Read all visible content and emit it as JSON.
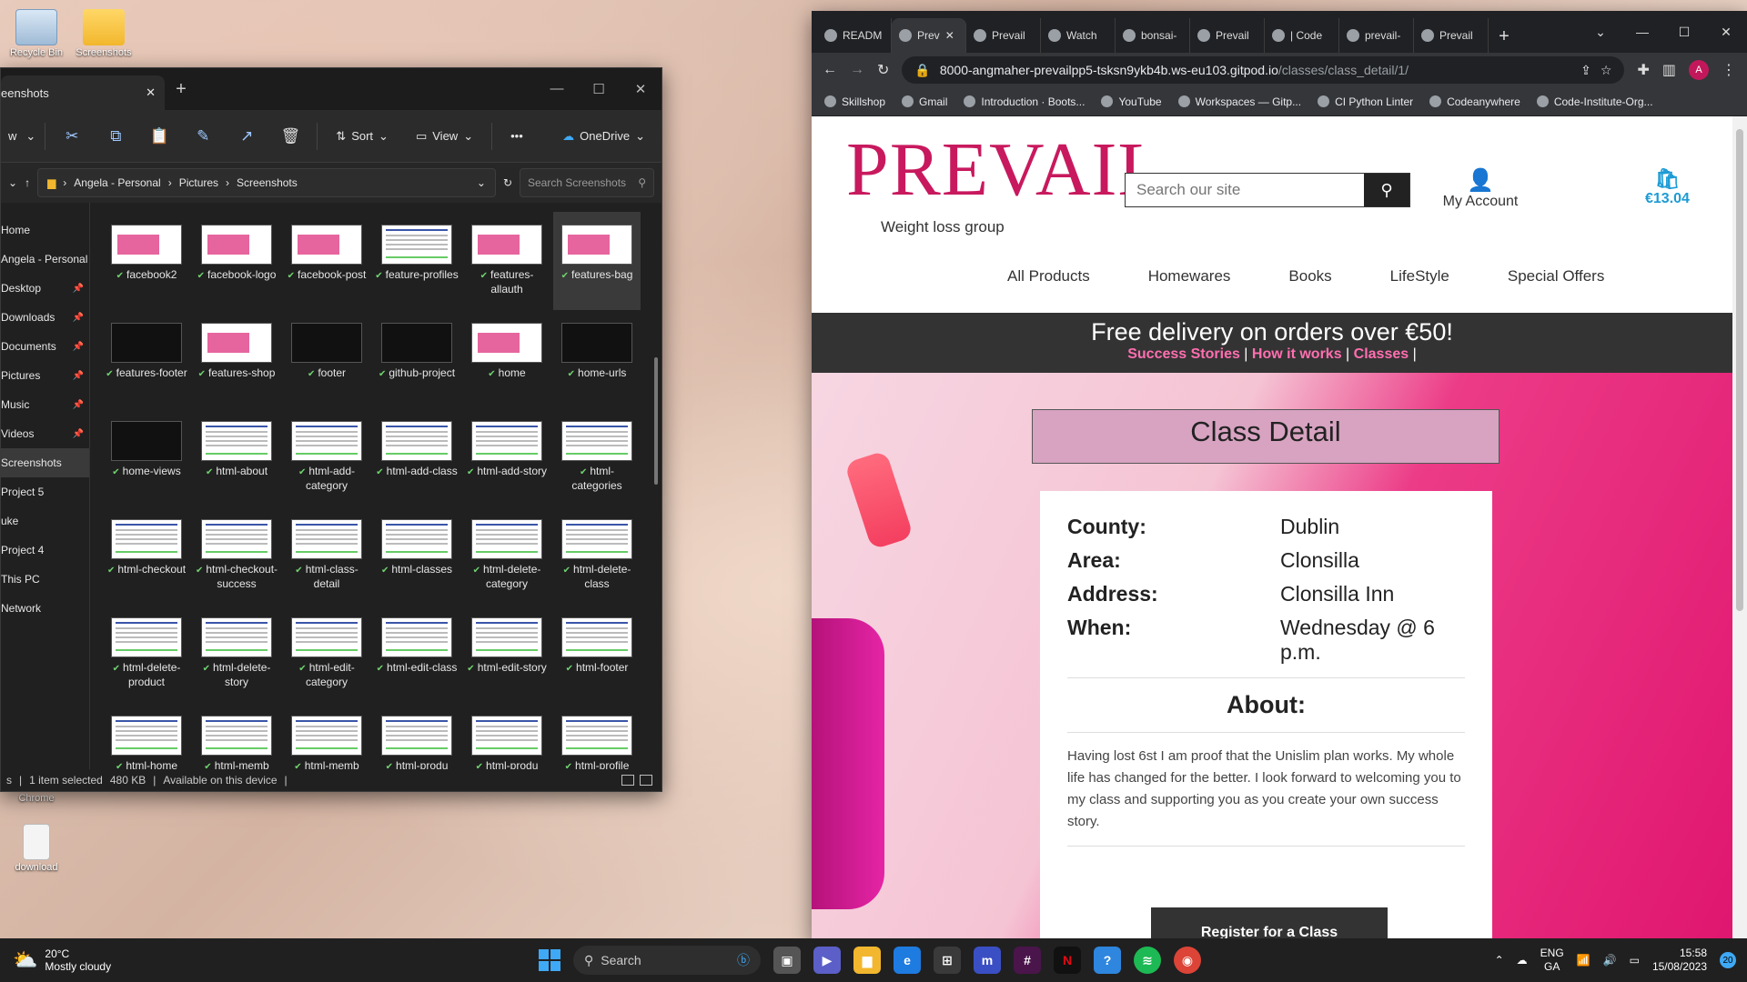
{
  "desktop": {
    "icons": [
      {
        "label": "Recycle Bin"
      },
      {
        "label": "Screenshots"
      },
      {
        "label": "Chrome"
      },
      {
        "label": "download"
      }
    ]
  },
  "explorer": {
    "tab_title": "eenshots",
    "toolbar": {
      "sort": "Sort",
      "view": "View",
      "onedrive": "OneDrive",
      "more": "•••",
      "left_label": "w"
    },
    "breadcrumb": [
      "Angela - Personal",
      "Pictures",
      "Screenshots"
    ],
    "search_placeholder": "Search Screenshots",
    "nav": [
      {
        "label": "Home",
        "pinned": false
      },
      {
        "label": "Angela - Personal",
        "pinned": false
      },
      {
        "label": "Desktop",
        "pinned": true
      },
      {
        "label": "Downloads",
        "pinned": true
      },
      {
        "label": "Documents",
        "pinned": true
      },
      {
        "label": "Pictures",
        "pinned": true
      },
      {
        "label": "Music",
        "pinned": true
      },
      {
        "label": "Videos",
        "pinned": true
      },
      {
        "label": "Screenshots",
        "pinned": false
      },
      {
        "label": "Project 5",
        "pinned": false
      },
      {
        "label": "uke",
        "pinned": false
      },
      {
        "label": "Project 4",
        "pinned": false
      },
      {
        "label": "This PC",
        "pinned": false
      },
      {
        "label": "Network",
        "pinned": false
      }
    ],
    "files": [
      {
        "name": "facebook2",
        "kind": "pink"
      },
      {
        "name": "facebook-logo",
        "kind": "pink"
      },
      {
        "name": "facebook-post",
        "kind": "pink"
      },
      {
        "name": "feature-profiles",
        "kind": "doc"
      },
      {
        "name": "features-allauth",
        "kind": "pink"
      },
      {
        "name": "features-bag",
        "kind": "pink"
      },
      {
        "name": "features-footer",
        "kind": "dark"
      },
      {
        "name": "features-shop",
        "kind": "pink"
      },
      {
        "name": "footer",
        "kind": "dark"
      },
      {
        "name": "github-project",
        "kind": "dark"
      },
      {
        "name": "home",
        "kind": "pink"
      },
      {
        "name": "home-urls",
        "kind": "dark"
      },
      {
        "name": "home-views",
        "kind": "dark"
      },
      {
        "name": "html-about",
        "kind": "doc"
      },
      {
        "name": "html-add-category",
        "kind": "doc"
      },
      {
        "name": "html-add-class",
        "kind": "doc"
      },
      {
        "name": "html-add-story",
        "kind": "doc"
      },
      {
        "name": "html-categories",
        "kind": "doc"
      },
      {
        "name": "html-checkout",
        "kind": "doc"
      },
      {
        "name": "html-checkout-success",
        "kind": "doc"
      },
      {
        "name": "html-class-detail",
        "kind": "doc"
      },
      {
        "name": "html-classes",
        "kind": "doc"
      },
      {
        "name": "html-delete-category",
        "kind": "doc"
      },
      {
        "name": "html-delete-class",
        "kind": "doc"
      },
      {
        "name": "html-delete-product",
        "kind": "doc"
      },
      {
        "name": "html-delete-story",
        "kind": "doc"
      },
      {
        "name": "html-edit-category",
        "kind": "doc"
      },
      {
        "name": "html-edit-class",
        "kind": "doc"
      },
      {
        "name": "html-edit-story",
        "kind": "doc"
      },
      {
        "name": "html-footer",
        "kind": "doc"
      },
      {
        "name": "html-home",
        "kind": "doc"
      },
      {
        "name": "html-memb",
        "kind": "doc"
      },
      {
        "name": "html-memb",
        "kind": "doc"
      },
      {
        "name": "html-produ",
        "kind": "doc"
      },
      {
        "name": "html-produ",
        "kind": "doc"
      },
      {
        "name": "html-profile",
        "kind": "doc"
      }
    ],
    "status": {
      "count": "s",
      "selected": "1 item selected",
      "size": "480 KB",
      "availability": "Available on this device"
    }
  },
  "chrome": {
    "tabs": [
      {
        "title": "READM",
        "active": false
      },
      {
        "title": "Prev",
        "active": true
      },
      {
        "title": "Prevail",
        "active": false
      },
      {
        "title": "Watch",
        "active": false
      },
      {
        "title": "bonsai-",
        "active": false
      },
      {
        "title": "Prevail",
        "active": false
      },
      {
        "title": "| Code",
        "active": false
      },
      {
        "title": "prevail-",
        "active": false
      },
      {
        "title": "Prevail",
        "active": false
      }
    ],
    "url_host": "8000-angmaher-prevailpp5-tsksn9ykb4b.ws-eu103.gitpod.io",
    "url_path": "/classes/class_detail/1/",
    "profile_initial": "A",
    "bookmarks": [
      "Skillshop",
      "Gmail",
      "Introduction · Boots...",
      "YouTube",
      "Workspaces — Gitp...",
      "CI Python Linter",
      "Codeanywhere",
      "Code-Institute-Org..."
    ]
  },
  "site": {
    "logo": "PREVAIL",
    "tagline": "Weight loss group",
    "search_placeholder": "Search our site",
    "account": "My Account",
    "cart_total": "€13.04",
    "nav": [
      "All Products",
      "Homewares",
      "Books",
      "LifeStyle",
      "Special Offers"
    ],
    "banner": "Free delivery on orders over €50!",
    "banner_links": [
      "Success Stories",
      "How it works",
      "Classes"
    ],
    "page_title": "Class Detail",
    "details": [
      {
        "key": "County:",
        "value": "Dublin"
      },
      {
        "key": "Area:",
        "value": "Clonsilla"
      },
      {
        "key": "Address:",
        "value": "Clonsilla Inn"
      },
      {
        "key": "When:",
        "value": "Wednesday @ 6 p.m."
      }
    ],
    "about_heading": "About:",
    "about_text": "Having lost 6st I am proof that the Unislim plan works. My whole life has changed for the better. I look forward to welcoming you to my class and supporting you as you create your own success story.",
    "register_button": "Register for a Class"
  },
  "taskbar": {
    "temperature": "20°C",
    "weather": "Mostly cloudy",
    "search": "Search",
    "lang_top": "ENG",
    "lang_bottom": "GA",
    "time": "15:58",
    "date": "15/08/2023",
    "notifications": "20"
  }
}
